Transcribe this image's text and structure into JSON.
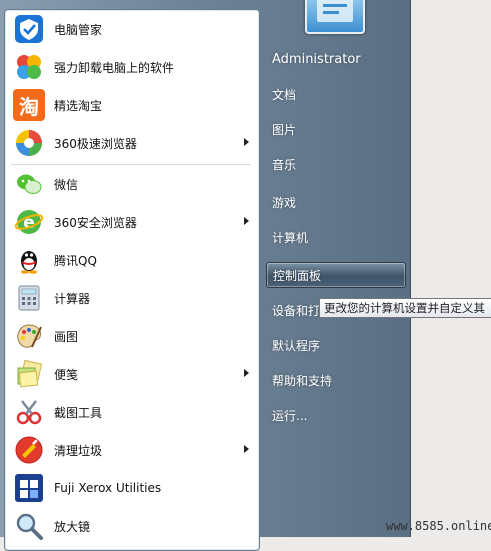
{
  "left_items": [
    {
      "label": "电脑管家",
      "icon": "tencent-pc-manager-icon",
      "submenu": false
    },
    {
      "label": "强力卸载电脑上的软件",
      "icon": "uninstaller-icon",
      "submenu": false
    },
    {
      "label": "精选淘宝",
      "icon": "taobao-icon",
      "icon_text": "淘",
      "submenu": false
    },
    {
      "label": "360极速浏览器",
      "icon": "360-chrome-icon",
      "submenu": true
    },
    {
      "label": "微信",
      "icon": "wechat-icon",
      "submenu": false
    },
    {
      "label": "360安全浏览器",
      "icon": "360-browser-icon",
      "submenu": true
    },
    {
      "label": "腾讯QQ",
      "icon": "qq-penguin-icon",
      "submenu": false
    },
    {
      "label": "计算器",
      "icon": "calculator-icon",
      "submenu": false
    },
    {
      "label": "画图",
      "icon": "paint-icon",
      "submenu": false
    },
    {
      "label": "便笺",
      "icon": "sticky-notes-icon",
      "submenu": true
    },
    {
      "label": "截图工具",
      "icon": "snipping-tool-icon",
      "submenu": false
    },
    {
      "label": "清理垃圾",
      "icon": "clean-junk-icon",
      "submenu": true
    },
    {
      "label": "Fuji Xerox Utilities",
      "icon": "fuji-xerox-icon",
      "submenu": false
    },
    {
      "label": "放大镜",
      "icon": "magnifier-icon",
      "submenu": false
    }
  ],
  "right_items": [
    {
      "label": "Administrator"
    },
    {
      "label": "文档"
    },
    {
      "label": "图片"
    },
    {
      "label": "音乐"
    },
    {
      "label": "游戏"
    },
    {
      "label": "计算机"
    },
    {
      "label": "控制面板"
    },
    {
      "label": "设备和打"
    },
    {
      "label": "默认程序"
    },
    {
      "label": "帮助和支持"
    },
    {
      "label": "运行..."
    }
  ],
  "tooltip": "更改您的计算机设置并自定义其",
  "watermark": "www.8585.online",
  "colors": {
    "right_pane": "#6f8498",
    "left_pane": "#ffffff",
    "taobao": "#f36a1b",
    "tencent_blue": "#1b73d6"
  }
}
